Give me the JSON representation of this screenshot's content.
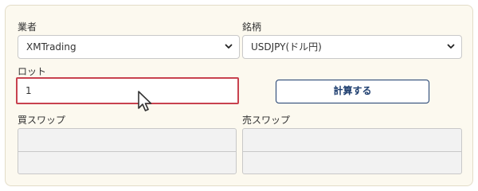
{
  "broker": {
    "label": "業者",
    "selected": "XMTrading",
    "icon": "chevron-down-icon"
  },
  "symbol": {
    "label": "銘柄",
    "selected": "USDJPY(ドル円)",
    "icon": "chevron-down-icon"
  },
  "lot": {
    "label": "ロット",
    "value": "1"
  },
  "calculate_button": {
    "label": "計算する"
  },
  "buy_swap": {
    "label": "買スワップ"
  },
  "sell_swap": {
    "label": "売スワップ"
  },
  "pointer": {
    "icon": "mouse-cursor-icon"
  },
  "colors": {
    "panel_bg": "#fcf9ef",
    "accent_navy": "#1d3d6e",
    "focus_red": "#c8424f",
    "readonly_bg": "#f2f2f2"
  }
}
